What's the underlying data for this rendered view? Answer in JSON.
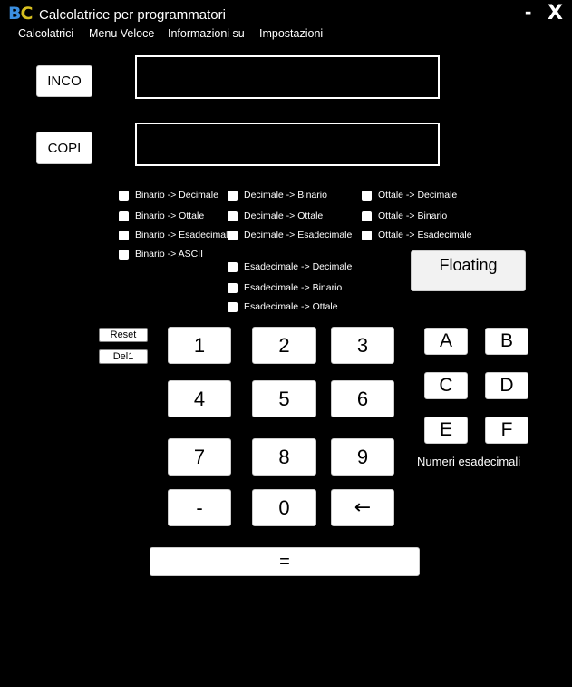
{
  "app": {
    "logo_b": "B",
    "logo_c": "C",
    "title": "Calcolatrice per programmatori",
    "minimize": "-",
    "close": "X"
  },
  "menu": [
    "Calcolatrici",
    "Menu Veloce",
    "Informazioni su",
    "Impostazioni"
  ],
  "fields": {
    "paste_label": "INCO",
    "paste_value": "",
    "copy_label": "COPI",
    "copy_value": ""
  },
  "conversions": {
    "col1": [
      "Binario -> Decimale",
      "Binario -> Ottale",
      "Binario -> Esadecimale",
      "Binario -> ASCII"
    ],
    "col2": [
      "Decimale -> Binario",
      "Decimale -> Ottale",
      "Decimale -> Esadecimale"
    ],
    "col2b": [
      "Esadecimale -> Decimale",
      "Esadecimale -> Binario",
      "Esadecimale -> Ottale"
    ],
    "col3": [
      "Ottale -> Decimale",
      "Ottale -> Binario",
      "Ottale -> Esadecimale"
    ]
  },
  "floating_label": "Floating",
  "reset_label": "Reset",
  "del1_label": "Del1",
  "keypad": [
    "1",
    "2",
    "3",
    "4",
    "5",
    "6",
    "7",
    "8",
    "9",
    "-",
    "0",
    "←"
  ],
  "equals_label": "=",
  "hex_keys": [
    "A",
    "B",
    "C",
    "D",
    "E",
    "F"
  ],
  "hex_caption": "Numeri esadecimali"
}
